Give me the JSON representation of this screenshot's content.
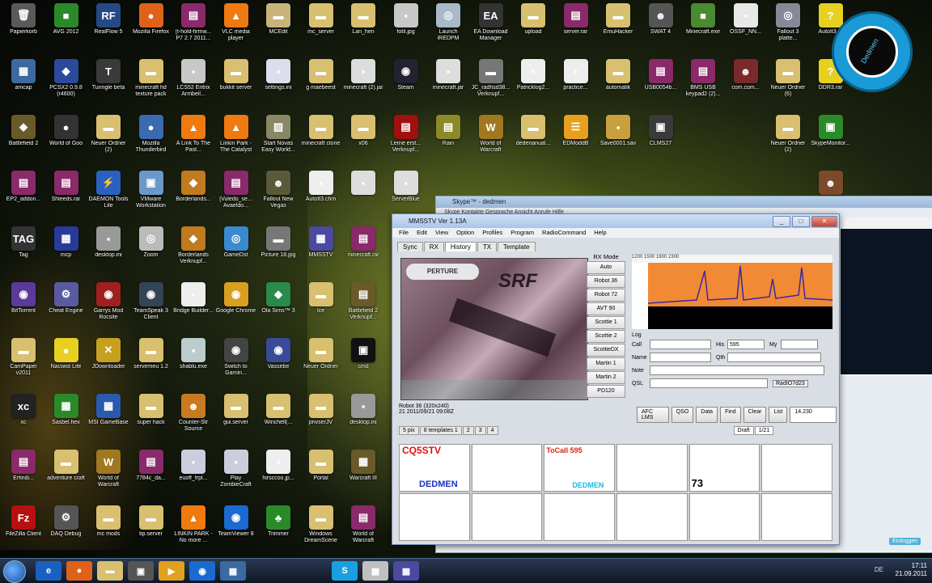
{
  "desktop": {
    "rows": [
      [
        {
          "label": "Papierkorb",
          "icon": "🗑",
          "color": "#5a5a5a"
        },
        {
          "label": "AVG 2012",
          "icon": "■",
          "color": "#2a8a2a"
        },
        {
          "label": "RealFlow 5",
          "icon": "RF",
          "color": "#244a84"
        },
        {
          "label": "Mozilla Firefox",
          "icon": "●",
          "color": "#e0621a"
        },
        {
          "label": "[t-hold-firmw... P7 2.7 2011...",
          "icon": "▤",
          "color": "#8a2a6a"
        },
        {
          "label": "VLC media player",
          "icon": "▲",
          "color": "#ee7a10"
        },
        {
          "label": "MCEdit",
          "icon": "▬",
          "color": "#c8b47a"
        },
        {
          "label": "mc_server",
          "icon": "▬",
          "color": "#d8c070"
        },
        {
          "label": "Lan_hen",
          "icon": "▬",
          "color": "#d8c070"
        },
        {
          "label": "fotil.jpg",
          "icon": "▪",
          "color": "#c8c8c8"
        },
        {
          "label": "Launch iREDPM",
          "icon": "◎",
          "color": "#aab8c8"
        },
        {
          "label": "EA Download Manager",
          "icon": "EA",
          "color": "#333"
        },
        {
          "label": "upload",
          "icon": "▬",
          "color": "#d8c070"
        },
        {
          "label": "server.rar",
          "icon": "▤",
          "color": "#8a2a6a"
        },
        {
          "label": "EmuHacker",
          "icon": "▬",
          "color": "#d8c070"
        },
        {
          "label": "SWAT 4",
          "icon": "☻",
          "color": "#555"
        },
        {
          "label": "Minecraft.exe",
          "icon": "■",
          "color": "#4a8a30"
        },
        {
          "label": "OSSF_NN...",
          "icon": "▪",
          "color": "#e8e8e8"
        },
        {
          "label": "Fallout 3 platte...",
          "icon": "◎",
          "color": "#889"
        },
        {
          "label": "AutoIt3 ...",
          "icon": "?",
          "color": "#e8d020"
        }
      ],
      [
        {
          "label": "amcap",
          "icon": "▦",
          "color": "#3a6aa0"
        },
        {
          "label": "PCSX2 0.9.8 (r4600)",
          "icon": "◆",
          "color": "#2a4a9a"
        },
        {
          "label": "Tunngle beta",
          "icon": "T",
          "color": "#3a3a3a"
        },
        {
          "label": "minecraft hd texture pack",
          "icon": "▬",
          "color": "#d8c070"
        },
        {
          "label": "LCS52 Entrix Armbeil...",
          "icon": "▪",
          "color": "#c8c8c8"
        },
        {
          "label": "bukkit server",
          "icon": "▬",
          "color": "#d8c070"
        },
        {
          "label": "settings.ini",
          "icon": "▪",
          "color": "#dde"
        },
        {
          "label": "g maebeest",
          "icon": "▬",
          "color": "#d8c070"
        },
        {
          "label": "minecraft (2).jar",
          "icon": "▪",
          "color": "#ddd"
        },
        {
          "label": "Steam",
          "icon": "◉",
          "color": "#223"
        },
        {
          "label": "minecraft.jar",
          "icon": "▪",
          "color": "#ddd"
        },
        {
          "label": "JC_radhsd38... Verknupf...",
          "icon": "▬",
          "color": "#777"
        },
        {
          "label": "Patricklog2...",
          "icon": "▪",
          "color": "#eee"
        },
        {
          "label": "practice...",
          "icon": "▪",
          "color": "#eee"
        },
        {
          "label": "automatik",
          "icon": "▬",
          "color": "#d8c070"
        },
        {
          "label": "USB0054b...",
          "icon": "▤",
          "color": "#8a2a6a"
        },
        {
          "label": "BMS USB keypad2 (2)...",
          "icon": "▤",
          "color": "#8a2a6a"
        },
        {
          "label": "com.com...",
          "icon": "☻",
          "color": "#7a2a2a"
        },
        {
          "label": "Neuer Ordner (6)",
          "icon": "▬",
          "color": "#d8c070"
        },
        {
          "label": "DDR3.rar",
          "icon": "?",
          "color": "#e8d020"
        }
      ],
      [
        {
          "label": "Battlefield 2",
          "icon": "◆",
          "color": "#6a5a2a"
        },
        {
          "label": "World of Goo",
          "icon": "●",
          "color": "#333"
        },
        {
          "label": "Neuer Ordner (2)",
          "icon": "▬",
          "color": "#d8c070"
        },
        {
          "label": "Mozilla Thunderbird",
          "icon": "●",
          "color": "#3a6ab0"
        },
        {
          "label": "A Link To The Past...",
          "icon": "▲",
          "color": "#ee7a10"
        },
        {
          "label": "Linkin Park - The Catalyst",
          "icon": "▲",
          "color": "#ee7a10"
        },
        {
          "label": "Start Novas Easy World...",
          "icon": "▨",
          "color": "#886"
        },
        {
          "label": "minecraft clone",
          "icon": "▬",
          "color": "#d8c070"
        },
        {
          "label": "x06",
          "icon": "▬",
          "color": "#d8c070"
        },
        {
          "label": "Lerne erst... Verknupf...",
          "icon": "▤",
          "color": "#a01010"
        },
        {
          "label": "Rain",
          "icon": "▤",
          "color": "#8a8a2a"
        },
        {
          "label": "World of Warcraft",
          "icon": "W",
          "color": "#a07820"
        },
        {
          "label": "dedenanual...",
          "icon": "▬",
          "color": "#d8c070"
        },
        {
          "label": "EDModdB",
          "icon": "☰",
          "color": "#e8a020"
        },
        {
          "label": "Save0001.sav",
          "icon": "▪",
          "color": "#c8a040"
        },
        {
          "label": "CLMS27",
          "icon": "▣",
          "color": "#3a3a3a"
        },
        {
          "label": "",
          "icon": "",
          "color": "transparent"
        },
        {
          "label": "",
          "icon": "",
          "color": "transparent"
        },
        {
          "label": "Neuer Ordner (2)",
          "icon": "▬",
          "color": "#d8c070"
        },
        {
          "label": "SkypeMonitor...",
          "icon": "▣",
          "color": "#2a8a2a"
        }
      ],
      [
        {
          "label": "EP2_addon...",
          "icon": "▤",
          "color": "#8a2a6a"
        },
        {
          "label": "Shleeds.rar",
          "icon": "▤",
          "color": "#8a2a6a"
        },
        {
          "label": "DAEMON Tools Lite",
          "icon": "⚡",
          "color": "#2a60c0"
        },
        {
          "label": "VMware Workstation",
          "icon": "▣",
          "color": "#6a98c8"
        },
        {
          "label": "Borderlands...",
          "icon": "◆",
          "color": "#c07a20"
        },
        {
          "label": "[Vuledo_se... Avaeldo...",
          "icon": "▤",
          "color": "#8a2a6a"
        },
        {
          "label": "Fallout New Vegas",
          "icon": "☻",
          "color": "#5a5a3a"
        },
        {
          "label": "AutoIt3.chm",
          "icon": "▪",
          "color": "#eee"
        },
        {
          "label": "",
          "icon": "▪",
          "color": "#ddd"
        },
        {
          "label": "ServerBlue",
          "icon": "▪",
          "color": "#ddd"
        },
        {
          "label": "",
          "icon": "",
          "color": "transparent"
        },
        {
          "label": "",
          "icon": "",
          "color": "transparent"
        },
        {
          "label": "",
          "icon": "",
          "color": "transparent"
        },
        {
          "label": "",
          "icon": "",
          "color": "transparent"
        },
        {
          "label": "",
          "icon": "",
          "color": "transparent"
        },
        {
          "label": "",
          "icon": "",
          "color": "transparent"
        },
        {
          "label": "",
          "icon": "",
          "color": "transparent"
        },
        {
          "label": "",
          "icon": "",
          "color": "transparent"
        },
        {
          "label": "",
          "icon": "",
          "color": "transparent"
        },
        {
          "label": "",
          "icon": "☻",
          "color": "#7a4a2a"
        }
      ],
      [
        {
          "label": "Tag",
          "icon": "TAG",
          "color": "#333"
        },
        {
          "label": "mcp",
          "icon": "▦",
          "color": "#2a3a9a"
        },
        {
          "label": "desktop.ini",
          "icon": "▪",
          "color": "#999"
        },
        {
          "label": "Zoom",
          "icon": "◎",
          "color": "#bbb"
        },
        {
          "label": "Borderlands Verknupf...",
          "icon": "◆",
          "color": "#c07a20"
        },
        {
          "label": "GameDst",
          "icon": "◎",
          "color": "#3a8ad0"
        },
        {
          "label": "Picture 18.jpg",
          "icon": "▬",
          "color": "#777"
        },
        {
          "label": "MMSSTV",
          "icon": "▦",
          "color": "#4a4aa0"
        },
        {
          "label": "minecraft.rar",
          "icon": "▤",
          "color": "#8a2a6a"
        }
      ],
      [
        {
          "label": "BitTorrent",
          "icon": "◉",
          "color": "#5a3a9a"
        },
        {
          "label": "Cheat Engine",
          "icon": "⚙",
          "color": "#5a5aa0"
        },
        {
          "label": "Garrys Mod Rocsite",
          "icon": "◉",
          "color": "#a02020"
        },
        {
          "label": "TeamSpeak 3 Client",
          "icon": "◉",
          "color": "#345"
        },
        {
          "label": "Bridge Builder...",
          "icon": "▪",
          "color": "#eee"
        },
        {
          "label": "Google Chrome",
          "icon": "◉",
          "color": "#d8a020"
        },
        {
          "label": "Ola Sims™ 3",
          "icon": "◆",
          "color": "#2a8a4a"
        },
        {
          "label": "Ice",
          "icon": "▬",
          "color": "#d8c070"
        },
        {
          "label": "Battlefield 2 Verknupf...",
          "icon": "▤",
          "color": "#6a5a2a"
        }
      ],
      [
        {
          "label": "CamPaper v2011",
          "icon": "▬",
          "color": "#d8c070"
        },
        {
          "label": "Nacwist Lite",
          "icon": "●",
          "color": "#e8d020"
        },
        {
          "label": "JDownloader",
          "icon": "✕",
          "color": "#c8a020"
        },
        {
          "label": "serverneu 1.2",
          "icon": "▬",
          "color": "#d8c070"
        },
        {
          "label": "shablu.exe",
          "icon": "▪",
          "color": "#bcc"
        },
        {
          "label": "Switch to Garnin...",
          "icon": "◉",
          "color": "#444"
        },
        {
          "label": "Vassebe",
          "icon": "◉",
          "color": "#3a4a9a"
        },
        {
          "label": "Neuer Ordner",
          "icon": "▬",
          "color": "#d8c070"
        },
        {
          "label": "cmd",
          "icon": "▣",
          "color": "#111"
        }
      ],
      [
        {
          "label": "xc",
          "icon": "xc",
          "color": "#222"
        },
        {
          "label": "Sasbel.hex",
          "icon": "▦",
          "color": "#2a8a2a"
        },
        {
          "label": "MSI GameBase",
          "icon": "▦",
          "color": "#2a5ab0"
        },
        {
          "label": "super hack",
          "icon": "▬",
          "color": "#d8c070"
        },
        {
          "label": "Counter-Str Source",
          "icon": "☻",
          "color": "#c87a20"
        },
        {
          "label": "gui.server",
          "icon": "▬",
          "color": "#d8c070"
        },
        {
          "label": "Winchell(...",
          "icon": "▬",
          "color": "#d8c070"
        },
        {
          "label": "privserJV",
          "icon": "▬",
          "color": "#d8c070"
        },
        {
          "label": "desktop.ini",
          "icon": "▪",
          "color": "#999"
        }
      ],
      [
        {
          "label": "Erfindi...",
          "icon": "▤",
          "color": "#8a2a6a"
        },
        {
          "label": "adventure craft",
          "icon": "▬",
          "color": "#d8c070"
        },
        {
          "label": "World of Warcraft",
          "icon": "W",
          "color": "#a07820"
        },
        {
          "label": "7784c_da...",
          "icon": "▤",
          "color": "#8a2a6a"
        },
        {
          "label": "euoff_frpl...",
          "icon": "▪",
          "color": "#ccd"
        },
        {
          "label": "Play ZombieCraft",
          "icon": "▪",
          "color": "#ccd"
        },
        {
          "label": "hirsccoo.jp...",
          "icon": "▪",
          "color": "#eee"
        },
        {
          "label": "Portal",
          "icon": "▬",
          "color": "#d8c070"
        },
        {
          "label": "Warcraft III",
          "icon": "▦",
          "color": "#6a5a2a"
        }
      ],
      [
        {
          "label": "FileZilla Client",
          "icon": "Fz",
          "color": "#b81010"
        },
        {
          "label": "DAQ Debug",
          "icon": "⚙",
          "color": "#555"
        },
        {
          "label": "mc mods",
          "icon": "▬",
          "color": "#d8c070"
        },
        {
          "label": "tip.server",
          "icon": "▬",
          "color": "#d8c070"
        },
        {
          "label": "LINKIN PARK - No more ...",
          "icon": "▲",
          "color": "#ee7a10"
        },
        {
          "label": "TeamViewer 8",
          "icon": "◉",
          "color": "#1a6ad0"
        },
        {
          "label": "Trimmer",
          "icon": "♣",
          "color": "#2a8a2a"
        },
        {
          "label": "Windows DreamScene",
          "icon": "▬",
          "color": "#d8c070"
        },
        {
          "label": "World of Warcraft",
          "icon": "▤",
          "color": "#8a2a6a"
        }
      ]
    ]
  },
  "logo": {
    "text": "Dedmen"
  },
  "bg_window": {
    "title": "Skype™ - dedmen",
    "menu": "Skype   Kontakte   Gesprache   Ansicht   Anrufe   Hilfe",
    "tag": "Einloggen"
  },
  "mmsstv": {
    "title": "MMSSTV Ver 1.13A",
    "menu": [
      "File",
      "Edit",
      "View",
      "Option",
      "Profiles",
      "Program",
      "RadioCommand",
      "Help"
    ],
    "tabs": [
      "Sync",
      "RX",
      "History",
      "TX",
      "Template"
    ],
    "pic_header": "PERTURE",
    "pic_big": "SRF",
    "modes_title": "RX Mode",
    "modes": [
      "Auto",
      "Robot 36",
      "Robot 72",
      "AVT 90",
      "Scottie 1",
      "Scottie 2",
      "ScottieDX",
      "Martin 1",
      "Martin 2",
      "PD120"
    ],
    "spectrum_scale": "1200   1500   1800   2300",
    "log_title": "Log",
    "log_fields": [
      "Call",
      "His",
      "My",
      "Name",
      "Qth",
      "Note",
      "QSL"
    ],
    "his_value": "595",
    "rig": "RadIO7d23",
    "status_mode": "Robot 36 (320x240)",
    "status_date": "21 2011/09/21 09:08Z",
    "buttons": [
      "QSO",
      "Data",
      "Find",
      "Clear",
      "List"
    ],
    "freq": "14.230",
    "afc": "AFC  LMS",
    "draft": "Draft",
    "page": "1/21",
    "tmpl_tabs": [
      "5 pix",
      "8 templates 1",
      "2",
      "3",
      "4"
    ],
    "templates": {
      "t1": "CQ5STV",
      "t1b": "DEDMEN",
      "t3": "ToCall 595",
      "t3b": "DEDMEN",
      "t5": "73"
    }
  },
  "taskbar": {
    "time": "17:11",
    "date": "21.09.2011",
    "tray": "DE"
  },
  "taskbar_items": [
    {
      "icon": "e",
      "color": "#1a60c0"
    },
    {
      "icon": "●",
      "color": "#e0621a"
    },
    {
      "icon": "▬",
      "color": "#d8c070"
    },
    {
      "icon": "▣",
      "color": "#555"
    },
    {
      "icon": "▶",
      "color": "#e0a020"
    },
    {
      "icon": "◉",
      "color": "#1a6ad0"
    },
    {
      "icon": "▦",
      "color": "#3a6aa0"
    },
    {
      "icon": "S",
      "color": "#1aa0e0"
    },
    {
      "icon": "▦",
      "color": "#c0c0c0"
    },
    {
      "icon": "▦",
      "color": "#4a4aa0"
    }
  ]
}
